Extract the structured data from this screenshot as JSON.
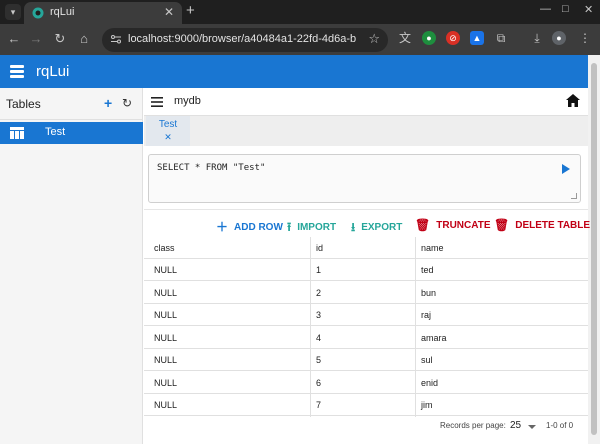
{
  "browser": {
    "tab_title": "rqLui",
    "url": "localhost:9000/browser/a40484a1-22fd-4d6a-b215...",
    "new_tab": "+",
    "minimize": "—",
    "maximize": "□",
    "close": "✕"
  },
  "app": {
    "title": "rqLui",
    "brand_color": "#1976d2"
  },
  "sidebar": {
    "heading": "Tables",
    "add_symbol": "+",
    "refresh_symbol": "↻",
    "tables": [
      {
        "name": "Test",
        "selected": true
      }
    ]
  },
  "main": {
    "database": "mydb",
    "query_tab": {
      "label": "Test",
      "close": "✕"
    },
    "query": "SELECT * FROM \"Test\""
  },
  "toolbar": {
    "add_row": "ADD ROW",
    "import": "IMPORT",
    "export": "EXPORT",
    "truncate": "TRUNCATE",
    "delete_table": "DELETE TABLE",
    "colors": {
      "add_row": "#1976d2",
      "import": "#26a69a",
      "export": "#26a69a",
      "truncate": "#c10015",
      "delete_table": "#c10015"
    }
  },
  "grid": {
    "columns": [
      "class",
      "id",
      "name"
    ],
    "rows": [
      [
        "NULL",
        "1",
        "ted"
      ],
      [
        "NULL",
        "2",
        "bun"
      ],
      [
        "NULL",
        "3",
        "raj"
      ],
      [
        "NULL",
        "4",
        "amara"
      ],
      [
        "NULL",
        "5",
        "sul"
      ],
      [
        "NULL",
        "6",
        "enid"
      ],
      [
        "NULL",
        "7",
        "jim"
      ]
    ]
  },
  "pagination": {
    "label": "Records per page:",
    "per_page": "25",
    "range": "1-0 of 0"
  }
}
